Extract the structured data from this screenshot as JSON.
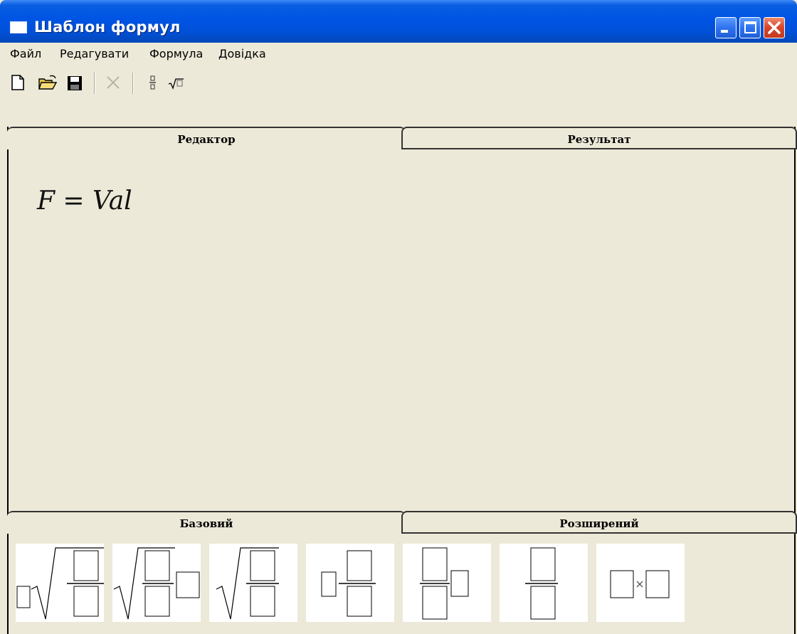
{
  "window": {
    "title": "Шаблон формул"
  },
  "menu": {
    "items": [
      "Файл",
      "Редагувати",
      "Формула",
      "Довідка"
    ]
  },
  "toolbar": {
    "buttons": [
      "new-file-icon",
      "open-folder-icon",
      "save-disk-icon",
      "delete-x-icon",
      "fraction-icon",
      "sqrt-icon"
    ]
  },
  "editor_tabs": {
    "active": "Редактор",
    "inactive": "Результат"
  },
  "editor": {
    "formula": "F = Val"
  },
  "template_tabs": {
    "active": "Базовий",
    "inactive": "Розширений"
  },
  "templates": [
    "root-with-index-fraction",
    "root-fraction-with-box",
    "root-fraction",
    "box-with-fraction",
    "fraction-with-box",
    "fraction",
    "box-times-box"
  ]
}
